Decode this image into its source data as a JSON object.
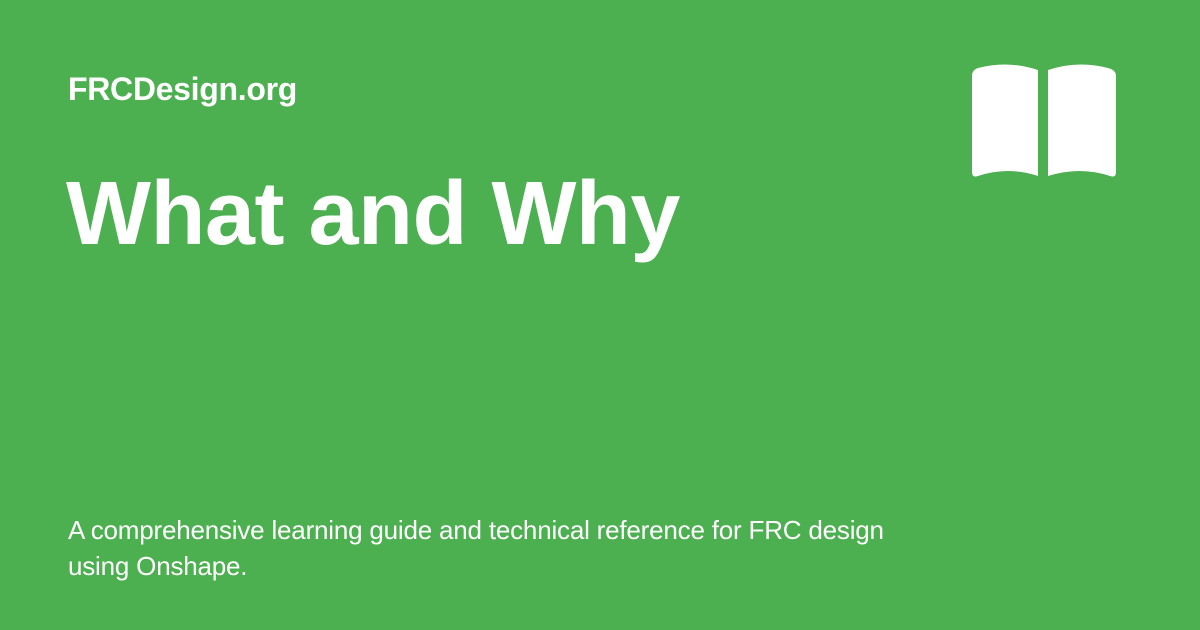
{
  "brand": {
    "site_name": "FRCDesign.org"
  },
  "page": {
    "title": "What and Why",
    "description": "A comprehensive learning guide and technical reference for FRC design using Onshape."
  },
  "icons": {
    "header_icon": "open-book-icon"
  },
  "colors": {
    "background": "#4caf50",
    "text": "#ffffff"
  }
}
